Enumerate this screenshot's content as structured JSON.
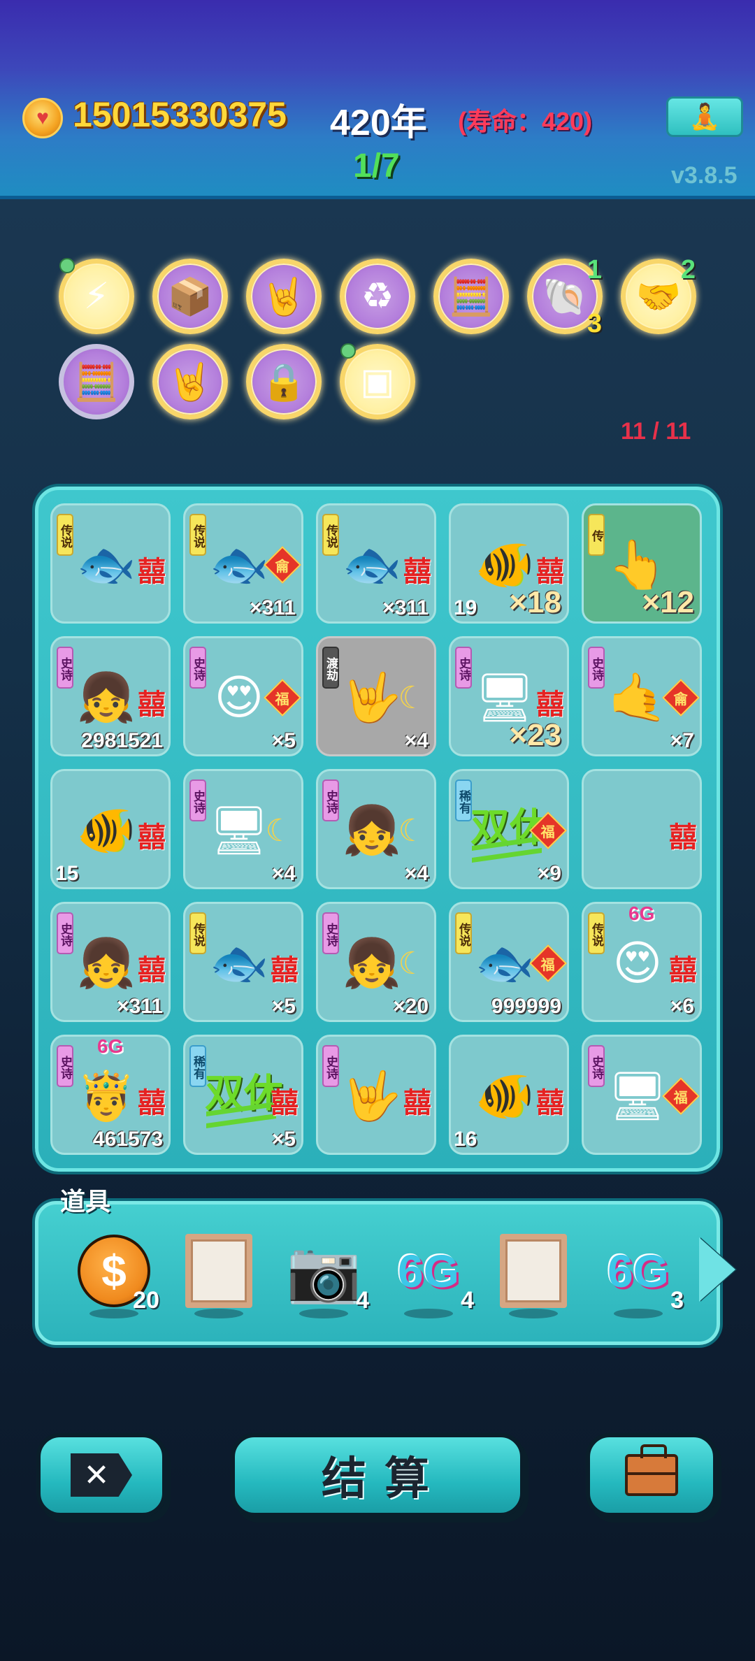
{
  "header": {
    "coins": "15015330375",
    "year": "420年",
    "lifespan": "(寿命：420)",
    "round": "1/7",
    "version": "v3.8.5",
    "meditate_icon": "meditation-icon"
  },
  "relics": {
    "count": "11 / 11",
    "row1": [
      {
        "icon": "lightning-icon",
        "glyph": "⚡",
        "style": "yellow",
        "pinned": true,
        "n1": "",
        "n2": ""
      },
      {
        "icon": "tissue-box-icon",
        "glyph": "📦",
        "style": "purple",
        "pinned": false,
        "n1": "",
        "n2": ""
      },
      {
        "icon": "rock-hand-icon",
        "glyph": "🤘",
        "style": "purple",
        "pinned": false,
        "n1": "",
        "n2": ""
      },
      {
        "icon": "recycle-icon",
        "glyph": "♻",
        "style": "purple",
        "pinned": false,
        "n1": "",
        "n2": ""
      },
      {
        "icon": "math-nerd-icon",
        "glyph": "🧮",
        "style": "purple",
        "pinned": false,
        "n1": "",
        "n2": ""
      },
      {
        "icon": "shell-icon",
        "glyph": "🐚",
        "style": "purple",
        "pinned": false,
        "n1": "1",
        "n2": "3"
      },
      {
        "icon": "handshake-icon",
        "glyph": "🤝",
        "style": "yellow",
        "pinned": false,
        "n1": "2",
        "n2": ""
      }
    ],
    "row2": [
      {
        "icon": "math-nerd-icon",
        "glyph": "🧮",
        "style": "purple-plain",
        "pinned": false
      },
      {
        "icon": "rock-hand-icon",
        "glyph": "🤘",
        "style": "purple",
        "pinned": false
      },
      {
        "icon": "safe-box-icon",
        "glyph": "🔒",
        "style": "purple",
        "pinned": false
      },
      {
        "icon": "chip-icon",
        "glyph": "▣",
        "style": "yellow",
        "pinned": true
      }
    ]
  },
  "board": {
    "tiles": [
      {
        "tag": "传说",
        "tagType": "legend",
        "art": "koi-fish-icon",
        "glyph": "🐟",
        "xi": "囍",
        "badge": "",
        "moon": false,
        "mult": "",
        "num": "",
        "six": "",
        "style": ""
      },
      {
        "tag": "传说",
        "tagType": "legend",
        "art": "koi-fish-icon",
        "glyph": "🐟",
        "xi": "",
        "badge": "龠",
        "moon": false,
        "mult": "×311",
        "num": "",
        "six": "",
        "style": ""
      },
      {
        "tag": "传说",
        "tagType": "legend",
        "art": "koi-fish-icon",
        "glyph": "🐟",
        "xi": "囍",
        "badge": "",
        "moon": false,
        "mult": "×311",
        "num": "",
        "six": "",
        "style": ""
      },
      {
        "tag": "",
        "tagType": "",
        "art": "goldfish-icon",
        "glyph": "🐠",
        "xi": "囍",
        "badge": "",
        "moon": false,
        "mult": "×18",
        "multBig": true,
        "num": "19",
        "six": "",
        "style": ""
      },
      {
        "tag": "传",
        "tagType": "legend",
        "art": "pointing-hand-icon",
        "glyph": "👆",
        "xi": "",
        "badge": "",
        "moon": false,
        "mult": "×12",
        "multBig": true,
        "num": "",
        "six": "",
        "style": "green"
      },
      {
        "tag": "史诗",
        "tagType": "epic",
        "art": "braided-girl-icon",
        "glyph": "👧",
        "xi": "囍",
        "badge": "",
        "moon": false,
        "mult": "2981521",
        "num": "",
        "six": "",
        "style": ""
      },
      {
        "tag": "史诗",
        "tagType": "epic",
        "art": "heart-eyes-girl-icon",
        "glyph": "😍",
        "xi": "",
        "badge": "福",
        "moon": false,
        "mult": "×5",
        "num": "",
        "six": "",
        "style": ""
      },
      {
        "tag": "渡劫",
        "tagType": "dujie",
        "art": "rock-hand-icon",
        "glyph": "🤟",
        "xi": "",
        "badge": "",
        "moon": true,
        "mult": "×4",
        "num": "",
        "six": "",
        "style": "gray"
      },
      {
        "tag": "史诗",
        "tagType": "epic",
        "art": "graphics-card-icon",
        "glyph": "🖥",
        "xi": "囍",
        "badge": "",
        "moon": false,
        "mult": "×23",
        "multBig": true,
        "num": "",
        "six": "",
        "style": ""
      },
      {
        "tag": "史诗",
        "tagType": "epic",
        "art": "gray-hand-icon",
        "glyph": "🤙",
        "xi": "",
        "badge": "龠",
        "moon": false,
        "mult": "×7",
        "num": "",
        "six": "",
        "style": ""
      },
      {
        "tag": "",
        "tagType": "",
        "art": "goldfish-icon",
        "glyph": "🐠",
        "xi": "囍",
        "badge": "",
        "moon": false,
        "mult": "",
        "num": "15",
        "six": "",
        "style": ""
      },
      {
        "tag": "史诗",
        "tagType": "epic",
        "art": "graphics-card-icon",
        "glyph": "🖥",
        "xi": "",
        "badge": "",
        "moon": true,
        "mult": "×4",
        "num": "",
        "six": "",
        "style": ""
      },
      {
        "tag": "史诗",
        "tagType": "epic",
        "art": "braided-girl-icon",
        "glyph": "👧",
        "xi": "",
        "badge": "",
        "moon": true,
        "mult": "×4",
        "num": "",
        "six": "",
        "style": ""
      },
      {
        "tag": "稀有",
        "tagType": "rare",
        "art": "shuangxiu-icon",
        "glyph": "",
        "xi": "",
        "badge": "福",
        "moon": false,
        "mult": "×9",
        "num": "",
        "six": "",
        "style": "",
        "shuangxiu": "双休"
      },
      {
        "tag": "",
        "tagType": "",
        "art": "empty-slot-icon",
        "glyph": "",
        "xi": "囍",
        "badge": "",
        "moon": false,
        "mult": "",
        "num": "",
        "six": "",
        "style": ""
      },
      {
        "tag": "史诗",
        "tagType": "epic",
        "art": "braided-girl-icon",
        "glyph": "👧",
        "xi": "囍",
        "badge": "",
        "moon": false,
        "mult": "×311",
        "num": "",
        "six": "",
        "style": ""
      },
      {
        "tag": "传说",
        "tagType": "legend",
        "art": "koi-fish-icon",
        "glyph": "🐟",
        "xi": "囍",
        "badge": "",
        "moon": false,
        "mult": "×5",
        "num": "",
        "six": "",
        "style": ""
      },
      {
        "tag": "史诗",
        "tagType": "epic",
        "art": "braided-girl-icon",
        "glyph": "👧",
        "xi": "",
        "badge": "",
        "moon": true,
        "mult": "×20",
        "num": "",
        "six": "",
        "style": ""
      },
      {
        "tag": "传说",
        "tagType": "legend",
        "art": "koi-fish-icon",
        "glyph": "🐟",
        "xi": "",
        "badge": "福",
        "moon": false,
        "mult": "999999",
        "num": "",
        "six": "",
        "style": ""
      },
      {
        "tag": "传说",
        "tagType": "legend",
        "art": "heart-eyes-man-icon",
        "glyph": "😍",
        "xi": "囍",
        "badge": "",
        "moon": false,
        "mult": "×6",
        "num": "",
        "six": "6G",
        "style": ""
      },
      {
        "tag": "史诗",
        "tagType": "epic",
        "art": "crowned-king-icon",
        "glyph": "🤴",
        "xi": "囍",
        "badge": "",
        "moon": false,
        "mult": "461573",
        "num": "",
        "six": "6G",
        "style": ""
      },
      {
        "tag": "稀有",
        "tagType": "rare",
        "art": "shuangxiu-icon",
        "glyph": "",
        "xi": "囍",
        "badge": "",
        "moon": false,
        "mult": "×5",
        "num": "",
        "six": "",
        "style": "",
        "shuangxiu": "双休"
      },
      {
        "tag": "史诗",
        "tagType": "epic",
        "art": "gray-hand-icon",
        "glyph": "🤟",
        "xi": "囍",
        "badge": "",
        "moon": false,
        "mult": "",
        "num": "",
        "six": "",
        "style": ""
      },
      {
        "tag": "",
        "tagType": "",
        "art": "goldfish-icon",
        "glyph": "🐠",
        "xi": "囍",
        "badge": "",
        "moon": false,
        "mult": "",
        "num": "16",
        "six": "",
        "style": ""
      },
      {
        "tag": "史诗",
        "tagType": "epic",
        "art": "graphics-card-icon",
        "glyph": "🖥",
        "xi": "",
        "badge": "福",
        "moon": false,
        "mult": "",
        "num": "",
        "six": "",
        "style": ""
      }
    ]
  },
  "items": {
    "label": "道具",
    "list": [
      {
        "name": "coin-item-icon",
        "type": "coin",
        "glyph": "$",
        "count": "20"
      },
      {
        "name": "picture-frame-icon",
        "type": "frame",
        "glyph": "",
        "count": ""
      },
      {
        "name": "camera-icon",
        "type": "camera",
        "glyph": "📷",
        "count": "4"
      },
      {
        "name": "6g-signal-icon",
        "type": "g6",
        "glyph": "6G",
        "count": "4"
      },
      {
        "name": "picture-frame-icon",
        "type": "frame",
        "glyph": "",
        "count": ""
      },
      {
        "name": "6g-signal-icon",
        "type": "g6",
        "glyph": "6G",
        "count": "3"
      }
    ]
  },
  "buttons": {
    "close_glyph": "✕",
    "settle_label": "结算",
    "bag_icon": "briefcase-icon"
  },
  "colors": {
    "coin_text": "#ffd83a",
    "lifespan_text": "#ff3b5a",
    "round_text": "#52e05a",
    "board": "#2bb0ba"
  }
}
